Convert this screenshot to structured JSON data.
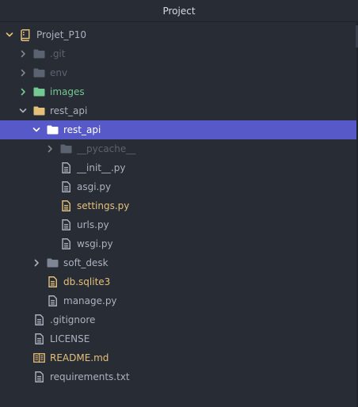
{
  "header": {
    "title": "Project"
  },
  "colors": {
    "background": "#282c34",
    "selection": "#5659c7",
    "default_text": "#abb2bf",
    "ignored_text": "#5c6370",
    "added_text": "#73c991",
    "modified_text": "#e5c07b"
  },
  "tree": [
    {
      "label": "Projet_P10",
      "type": "repo",
      "state": "expanded",
      "depth": 0,
      "status": "default",
      "selected": false
    },
    {
      "label": ".git",
      "type": "folder",
      "state": "collapsed",
      "depth": 1,
      "status": "ignored",
      "selected": false
    },
    {
      "label": "env",
      "type": "folder",
      "state": "collapsed",
      "depth": 1,
      "status": "ignored",
      "selected": false
    },
    {
      "label": "images",
      "type": "folder",
      "state": "collapsed",
      "depth": 1,
      "status": "added",
      "selected": false
    },
    {
      "label": "rest_api",
      "type": "folder",
      "state": "expanded",
      "depth": 1,
      "status": "default",
      "selected": false
    },
    {
      "label": "rest_api",
      "type": "folder",
      "state": "expanded",
      "depth": 2,
      "status": "default",
      "selected": true
    },
    {
      "label": "__pycache__",
      "type": "folder",
      "state": "collapsed",
      "depth": 3,
      "status": "ignored",
      "selected": false
    },
    {
      "label": "__init__.py",
      "type": "file",
      "depth": 3,
      "status": "default",
      "selected": false
    },
    {
      "label": "asgi.py",
      "type": "file",
      "depth": 3,
      "status": "default",
      "selected": false
    },
    {
      "label": "settings.py",
      "type": "file",
      "depth": 3,
      "status": "modified",
      "selected": false
    },
    {
      "label": "urls.py",
      "type": "file",
      "depth": 3,
      "status": "default",
      "selected": false
    },
    {
      "label": "wsgi.py",
      "type": "file",
      "depth": 3,
      "status": "default",
      "selected": false
    },
    {
      "label": "soft_desk",
      "type": "folder",
      "state": "collapsed",
      "depth": 2,
      "status": "default",
      "selected": false
    },
    {
      "label": "db.sqlite3",
      "type": "file",
      "depth": 2,
      "status": "modified",
      "selected": false
    },
    {
      "label": "manage.py",
      "type": "file",
      "depth": 2,
      "status": "default",
      "selected": false
    },
    {
      "label": ".gitignore",
      "type": "file",
      "depth": 1,
      "status": "default",
      "selected": false
    },
    {
      "label": "LICENSE",
      "type": "file",
      "depth": 1,
      "status": "default",
      "selected": false
    },
    {
      "label": "README.md",
      "type": "book",
      "depth": 1,
      "status": "modified",
      "selected": false
    },
    {
      "label": "requirements.txt",
      "type": "file",
      "depth": 1,
      "status": "default",
      "selected": false
    }
  ]
}
